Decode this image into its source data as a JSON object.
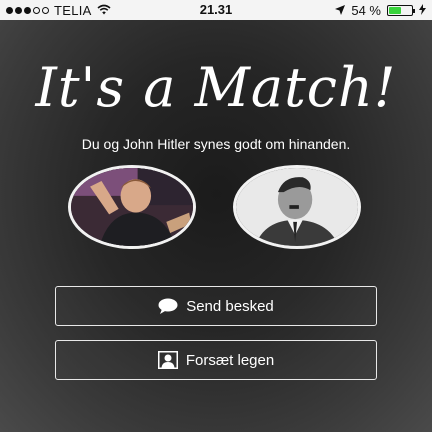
{
  "status_bar": {
    "carrier": "TELIA",
    "time": "21.31",
    "battery_percent": "54 %",
    "battery_level": 0.54,
    "signal_bars_filled": 3,
    "signal_bars_total": 5,
    "icons": [
      "wifi-icon",
      "location-arrow-icon",
      "battery-icon",
      "charging-bolt-icon"
    ],
    "battery_color": "#38d33b"
  },
  "match": {
    "title": "It's a Match!",
    "subtitle": "Du og John Hitler synes godt om hinanden."
  },
  "avatars": {
    "left": {
      "icon": "profile-photo"
    },
    "right": {
      "icon": "profile-photo"
    }
  },
  "buttons": {
    "send_message": {
      "label": "Send besked",
      "icon": "chat-bubble-icon"
    },
    "keep_playing": {
      "label": "Forsæt legen",
      "icon": "person-card-icon"
    }
  },
  "colors": {
    "background": "#2a2a2a",
    "text": "#ffffff",
    "button_border": "#e8e8e8"
  }
}
